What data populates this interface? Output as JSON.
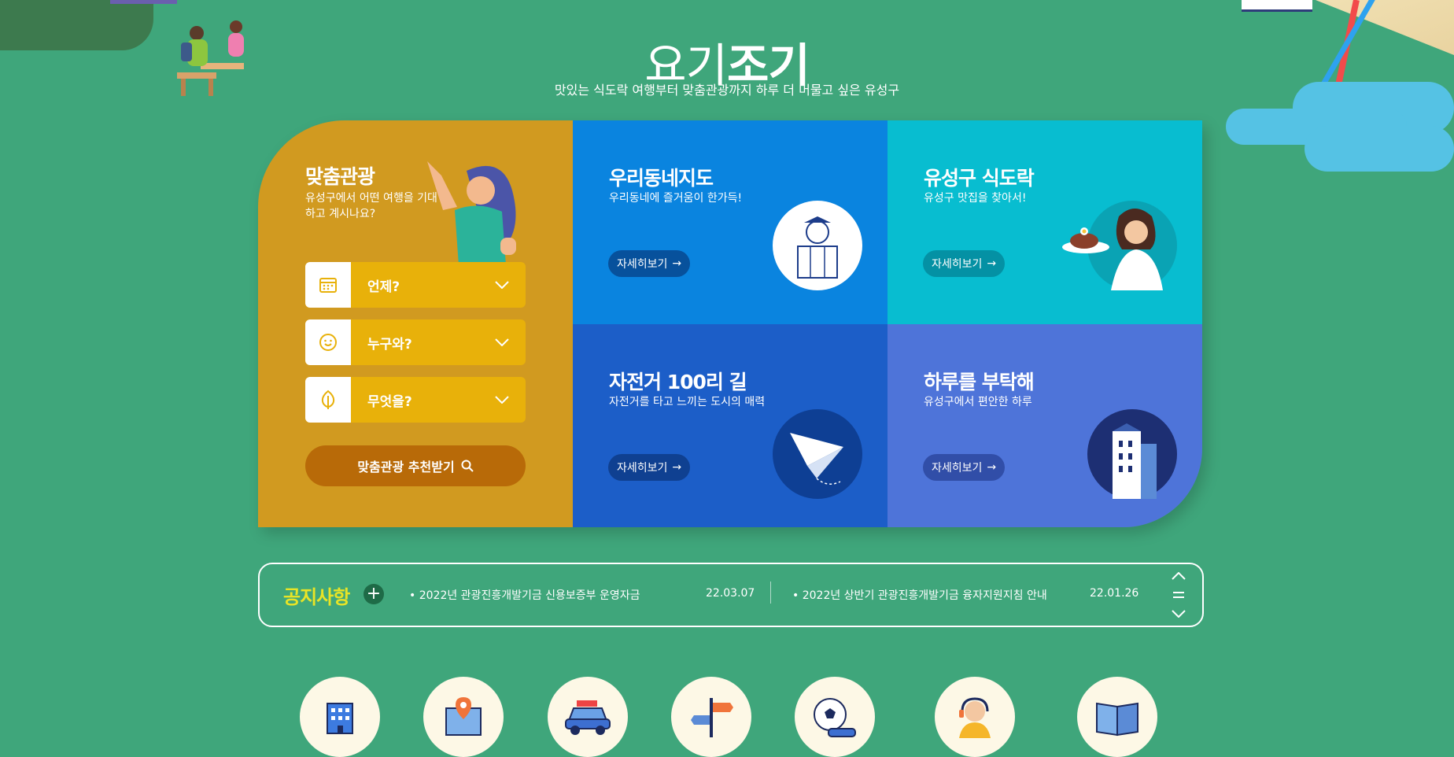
{
  "header": {
    "title_thin": "요기",
    "title_bold": "조기",
    "subtitle": "맛있는 식도락 여행부터 맞춤관광까지 하루 더 머물고 싶은 유성구"
  },
  "custom_tour": {
    "title": "맞춤관광",
    "desc": "유성구에서 어떤 여행을 기대하고 계시나요?",
    "selects": [
      {
        "label": "언제?",
        "icon": "calendar-icon"
      },
      {
        "label": "누구와?",
        "icon": "smile-icon"
      },
      {
        "label": "무엇을?",
        "icon": "tree-icon"
      }
    ],
    "button": "맞춤관광 추천받기"
  },
  "cards": [
    {
      "title": "우리동네지도",
      "desc": "우리동네에 즐거움이 한가득!",
      "button": "자세히보기"
    },
    {
      "title": "유성구 식도락",
      "desc": "유성구 맛집을 찾아서!",
      "button": "자세히보기"
    },
    {
      "title": "자전거 100리 길",
      "desc": "자전거를 타고 느끼는 도시의 매력",
      "button": "자세히보기"
    },
    {
      "title": "하루를 부탁해",
      "desc": "유성구에서 편안한 하루",
      "button": "자세히보기"
    }
  ],
  "notice": {
    "title": "공지사항",
    "items": [
      {
        "text": "2022년 관광진흥개발기금 신용보증부 운영자금",
        "date": "22.03.07"
      },
      {
        "text": "2022년 상반기 관광진흥개발기금 융자지원지침 안내",
        "date": "22.01.26"
      }
    ]
  },
  "quick_icons": [
    "building-icon",
    "map-pin-icon",
    "car-icon",
    "signpost-icon",
    "soccer-icon",
    "headset-icon",
    "book-icon"
  ],
  "colors": {
    "background": "#3fa67b",
    "custom": "#d19a20",
    "map": "#0a84df",
    "food": "#08bdd0",
    "bike": "#1c5ec8",
    "stay": "#4e74d9",
    "notice_title": "#e8e426"
  }
}
